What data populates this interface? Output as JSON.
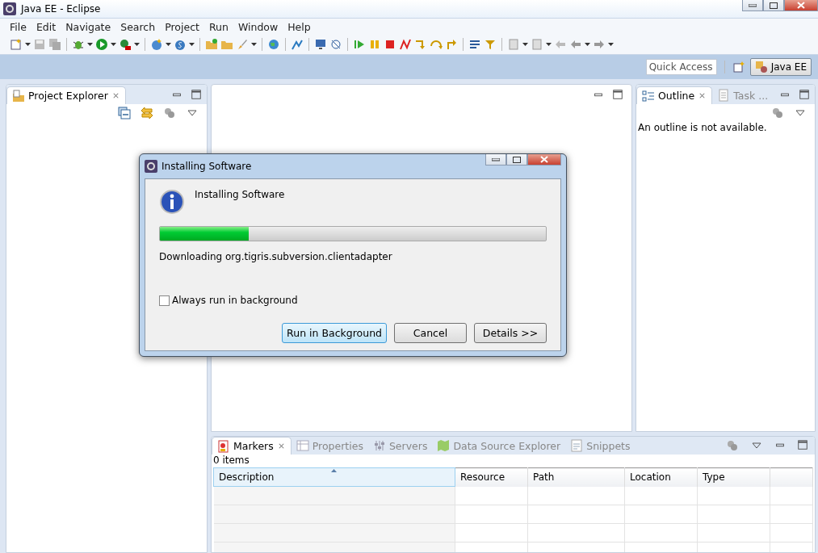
{
  "window": {
    "title": "Java EE - Eclipse"
  },
  "menu": [
    "File",
    "Edit",
    "Navigate",
    "Search",
    "Project",
    "Run",
    "Window",
    "Help"
  ],
  "quick_access": {
    "placeholder": "Quick Access"
  },
  "perspectives": [
    {
      "label": "Java EE",
      "selected": true
    }
  ],
  "left_view": {
    "tabs": [
      {
        "label": "Project Explorer",
        "selected": true
      }
    ]
  },
  "outline_view": {
    "tabs": [
      {
        "label": "Outline",
        "selected": true
      },
      {
        "label": "Task ...",
        "selected": false
      }
    ],
    "message": "An outline is not available."
  },
  "bottom_view": {
    "tabs": [
      {
        "label": "Markers",
        "selected": true
      },
      {
        "label": "Properties",
        "selected": false
      },
      {
        "label": "Servers",
        "selected": false
      },
      {
        "label": "Data Source Explorer",
        "selected": false
      },
      {
        "label": "Snippets",
        "selected": false
      }
    ],
    "summary": "0 items",
    "columns": [
      {
        "label": "Description",
        "sorted": true
      },
      {
        "label": "Resource",
        "sorted": false
      },
      {
        "label": "Path",
        "sorted": false
      },
      {
        "label": "Location",
        "sorted": false
      },
      {
        "label": "Type",
        "sorted": false
      }
    ]
  },
  "dialog": {
    "title": "Installing Software",
    "heading": "Installing Software",
    "progress": {
      "level": 0.23
    },
    "status": "Downloading org.tigris.subversion.clientadapter",
    "checkbox": {
      "label": "Always run in background",
      "checked": false
    },
    "buttons": [
      {
        "label": "Run in Background",
        "default": true
      },
      {
        "label": "Cancel",
        "default": false
      },
      {
        "label": "Details >>",
        "default": false
      }
    ]
  }
}
